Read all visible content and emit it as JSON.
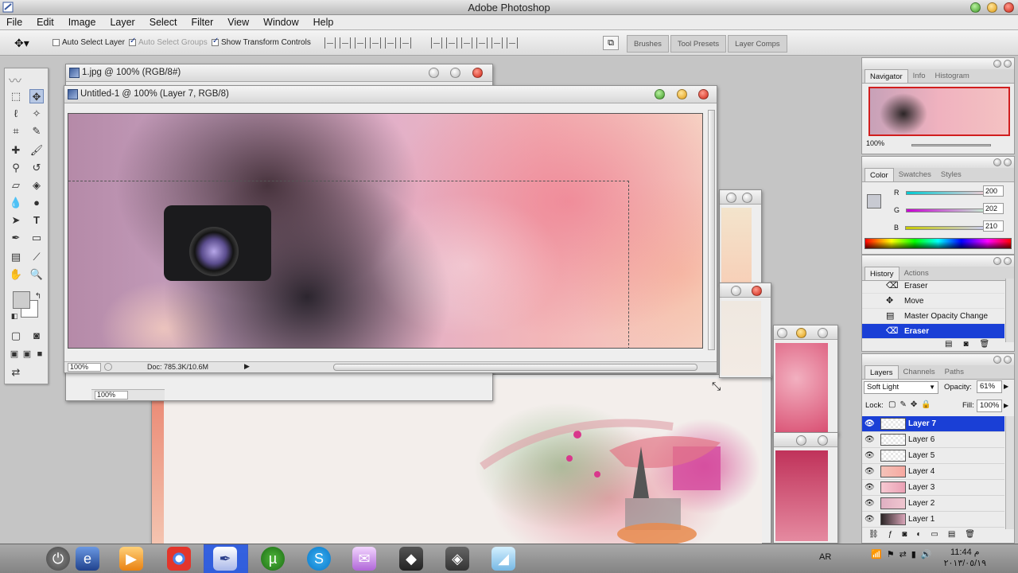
{
  "app": {
    "title": "Adobe Photoshop"
  },
  "menu": [
    "File",
    "Edit",
    "Image",
    "Layer",
    "Select",
    "Filter",
    "View",
    "Window",
    "Help"
  ],
  "options_bar": {
    "auto_select_layer": "Auto Select Layer",
    "auto_select_groups": "Auto Select Groups",
    "show_transform_controls": "Show Transform Controls",
    "well_tabs": [
      "Brushes",
      "Tool Presets",
      "Layer Comps"
    ]
  },
  "documents": {
    "back_doc_title": "1.jpg @ 100% (RGB/8#)",
    "back_doc_zoom": "100%",
    "main_doc_title": "Untitled-1 @ 100% (Layer 7, RGB/8)",
    "main_doc_zoom": "100%",
    "main_doc_size": "Doc: 785.3K/10.6M"
  },
  "navigator": {
    "tabs": [
      "Navigator",
      "Info",
      "Histogram"
    ],
    "zoom": "100%"
  },
  "color": {
    "tabs": [
      "Color",
      "Swatches",
      "Styles"
    ],
    "r_label": "R",
    "r": "200",
    "g_label": "G",
    "g": "202",
    "b_label": "B",
    "b": "210",
    "fg": "#c8cad2"
  },
  "history": {
    "tabs": [
      "History",
      "Actions"
    ],
    "items": [
      "Eraser",
      "Move",
      "Master Opacity Change",
      "Eraser"
    ]
  },
  "layers": {
    "tabs": [
      "Layers",
      "Channels",
      "Paths"
    ],
    "blend_mode": "Soft Light",
    "opacity_label": "Opacity:",
    "opacity": "61%",
    "lock_label": "Lock:",
    "fill_label": "Fill:",
    "fill": "100%",
    "items": [
      "Layer 7",
      "Layer 6",
      "Layer 5",
      "Layer 4",
      "Layer 3",
      "Layer 2",
      "Layer 1"
    ]
  },
  "taskbar": {
    "language": "AR",
    "time": "11:44 م",
    "date": "٢٠١٣/٠٥/١٩"
  }
}
